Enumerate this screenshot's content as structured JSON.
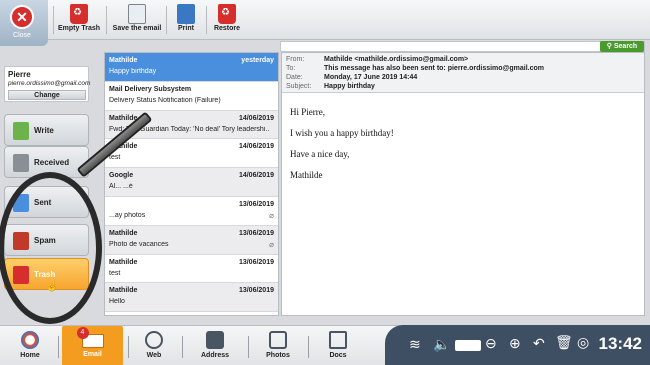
{
  "toolbar": {
    "close_label": "Close",
    "empty_trash": "Empty Trash",
    "save_email": "Save the email",
    "print": "Print",
    "restore": "Restore"
  },
  "search": {
    "button": "Search",
    "placeholder": ""
  },
  "user": {
    "name": "Pierre",
    "email": "pierre.ordissimo@gmail.com",
    "change": "Change"
  },
  "folders": [
    {
      "label": "Write",
      "icon": "write-icon"
    },
    {
      "label": "Received",
      "icon": "inbox-icon"
    },
    {
      "label": "Sent",
      "icon": "sent-icon"
    },
    {
      "label": "Spam",
      "icon": "spam-icon"
    },
    {
      "label": "Trash",
      "icon": "trash-icon",
      "active": true
    }
  ],
  "messages": [
    {
      "from": "Mathilde",
      "date": "yesterday",
      "subject": "Happy birthday",
      "selected": true
    },
    {
      "from": "Mail Delivery Subsystem",
      "date": "",
      "subject": "Delivery Status Notification (Failure)"
    },
    {
      "from": "Mathilde",
      "date": "14/06/2019",
      "subject": "Fwd: The Guardian Today: 'No deal' Tory leadershi..."
    },
    {
      "from": "Mathilde",
      "date": "14/06/2019",
      "subject": "test"
    },
    {
      "from": "Google",
      "date": "14/06/2019",
      "subject": "Al... ...é"
    },
    {
      "from": "",
      "date": "13/06/2019",
      "subject": "...ay photos",
      "attachment": true
    },
    {
      "from": "Mathilde",
      "date": "13/06/2019",
      "subject": "Photo de vacances",
      "attachment": true
    },
    {
      "from": "Mathilde",
      "date": "13/06/2019",
      "subject": "test"
    },
    {
      "from": "Mathilde",
      "date": "13/06/2019",
      "subject": "Hello"
    }
  ],
  "reader": {
    "from_k": "From:",
    "from_v": "Mathilde <mathilde.ordissimo@gmail.com>",
    "to_k": "To:",
    "to_v": "This message has also been sent to: pierre.ordissimo@gmail.com",
    "date_k": "Date:",
    "date_v": "Monday, 17 June 2019 14:44",
    "subject_k": "Subject:",
    "subject_v": "Happy birthday",
    "body": [
      "Hi Pierre,",
      "I wish you a happy birthday!",
      "Have a nice day,",
      "Mathilde"
    ]
  },
  "taskbar": {
    "home": "Home",
    "email": "Email",
    "email_badge": "4",
    "web": "Web",
    "address": "Address",
    "photos": "Photos",
    "docs": "Docs",
    "clock": "13:42"
  },
  "colors": {
    "accent": "#f39c1f",
    "selected": "#4a8fde",
    "status_bar": "#3f4f63",
    "close": "#d62d2d",
    "search": "#4a9a2e"
  }
}
